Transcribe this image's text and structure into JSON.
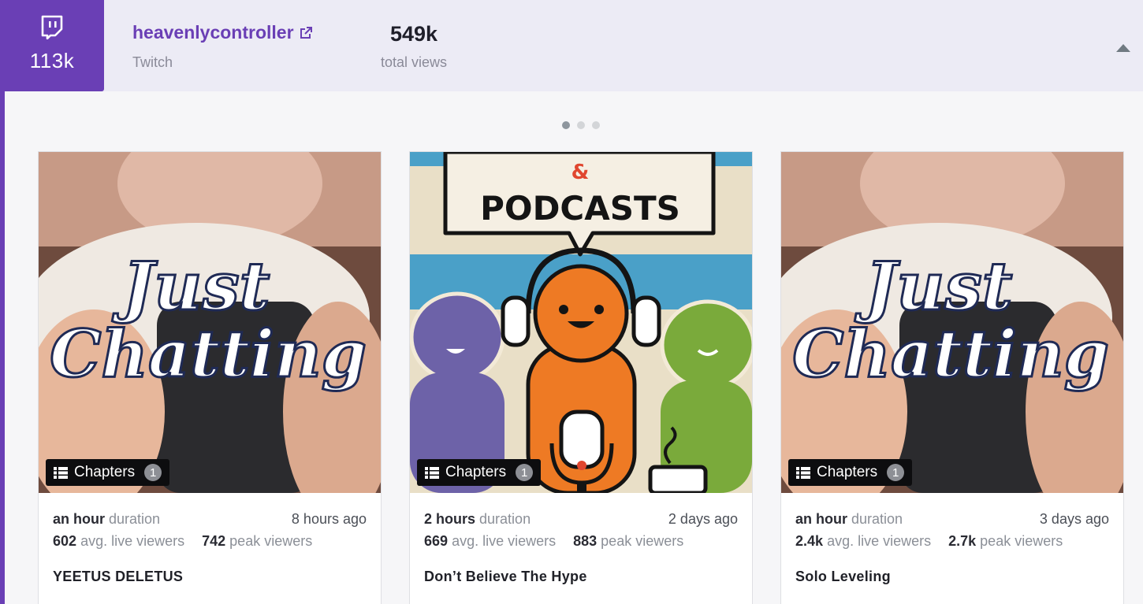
{
  "header": {
    "followers": "113k",
    "channel_name": "heavenlycontroller",
    "platform": "Twitch",
    "total_views_value": "549k",
    "total_views_label": "total views"
  },
  "carousel": {
    "active_index": 0,
    "dot_count": 3
  },
  "colors": {
    "brand": "#6a3fb5",
    "header_bg": "#ecebf5"
  },
  "cards": [
    {
      "thumbnail": "just-chatting",
      "thumb_text_1": "Just",
      "thumb_text_2": "Chatting",
      "chapters_label": "Chapters",
      "chapters_count": "1",
      "duration_value": "an hour",
      "duration_label": "duration",
      "time_ago": "8 hours ago",
      "avg_value": "602",
      "avg_label": "avg. live viewers",
      "peak_value": "742",
      "peak_label": "peak viewers",
      "title": "YEETUS DELETUS"
    },
    {
      "thumbnail": "talk-shows-podcasts",
      "thumb_text_1": "&",
      "thumb_text_2": "PODCASTS",
      "chapters_label": "Chapters",
      "chapters_count": "1",
      "duration_value": "2 hours",
      "duration_label": "duration",
      "time_ago": "2 days ago",
      "avg_value": "669",
      "avg_label": "avg. live viewers",
      "peak_value": "883",
      "peak_label": "peak viewers",
      "title": "Don’t Believe The Hype"
    },
    {
      "thumbnail": "just-chatting",
      "thumb_text_1": "Just",
      "thumb_text_2": "Chatting",
      "chapters_label": "Chapters",
      "chapters_count": "1",
      "duration_value": "an hour",
      "duration_label": "duration",
      "time_ago": "3 days ago",
      "avg_value": "2.4k",
      "avg_label": "avg. live viewers",
      "peak_value": "2.7k",
      "peak_label": "peak viewers",
      "title": "Solo Leveling"
    }
  ]
}
